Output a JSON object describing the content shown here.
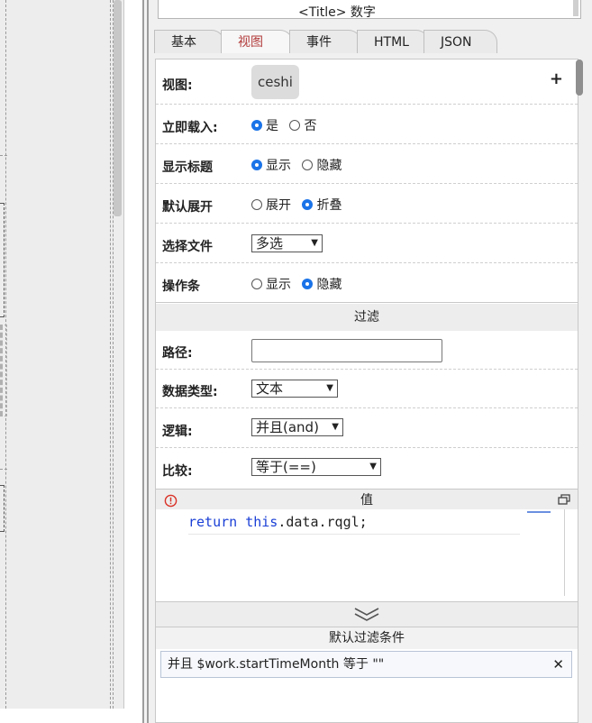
{
  "title_box": {
    "text": "<Title> 数字"
  },
  "tabs": [
    {
      "label": "基本"
    },
    {
      "label": "视图"
    },
    {
      "label": "事件"
    },
    {
      "label": "HTML"
    },
    {
      "label": "JSON"
    }
  ],
  "active_tab": "视图",
  "rows": {
    "view": {
      "label": "视图:",
      "chip": "ceshi",
      "add": "+"
    },
    "load": {
      "label": "立即载入:",
      "opt1": "是",
      "opt2": "否"
    },
    "show_title": {
      "label": "显示标题",
      "opt1": "显示",
      "opt2": "隐藏"
    },
    "expand": {
      "label": "默认展开",
      "opt1": "展开",
      "opt2": "折叠"
    },
    "file": {
      "label": "选择文件",
      "value": "多选"
    },
    "toolbar": {
      "label": "操作条",
      "opt1": "显示",
      "opt2": "隐藏"
    }
  },
  "filter": {
    "section_title": "过滤",
    "path_label": "路径:",
    "path_value": "",
    "datatype_label": "数据类型:",
    "datatype_value": "文本",
    "logic_label": "逻辑:",
    "logic_value": "并且(and)",
    "compare_label": "比较:",
    "compare_value": "等于(==)"
  },
  "value_editor": {
    "title": "值",
    "code_kw1": "return",
    "code_kw2": "this",
    "code_rest": ".data.rqgl;"
  },
  "default_filter": {
    "title": "默认过滤条件",
    "item": "并且 $work.startTimeMonth 等于 \"\"",
    "remove": "✕"
  },
  "colors": {
    "accent": "#1a73e8",
    "active_tab": "#b23a3a",
    "error": "#d93025"
  }
}
